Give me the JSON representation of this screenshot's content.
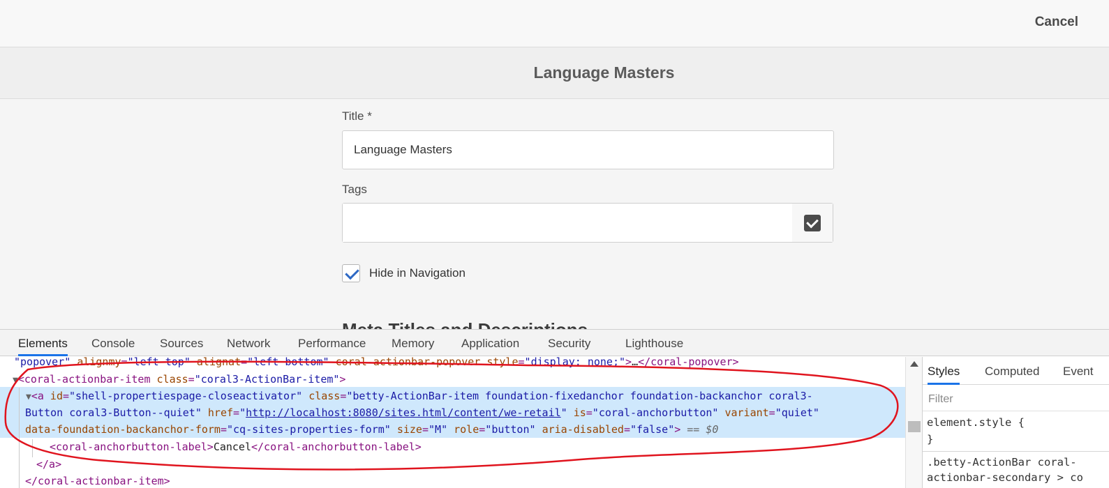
{
  "app": {
    "cancel_label": "Cancel",
    "page_title": "Language Masters",
    "title_field": {
      "label": "Title *",
      "value": "Language Masters"
    },
    "tags_field": {
      "label": "Tags",
      "value": ""
    },
    "hide_in_navigation": {
      "label": "Hide in Navigation",
      "checked": true
    },
    "next_section_heading": "Meta Titles and Descriptions"
  },
  "devtools": {
    "tabs": [
      "Elements",
      "Console",
      "Sources",
      "Network",
      "Performance",
      "Memory",
      "Application",
      "Security",
      "Lighthouse"
    ],
    "active_tab": "Elements",
    "dom": {
      "line0": {
        "v1": "popover",
        "a1": "alignmy",
        "v2": "left top",
        "a2": "alignat",
        "v3": "left bottom",
        "a3": "coral-actionbar-popover",
        "a4": "style",
        "v4": "display: none;",
        "ellipsis": "…",
        "close": "</coral-popover>"
      },
      "line1": {
        "open": "<coral-actionbar-item",
        "a1": "class",
        "v1": "coral3-ActionBar-item",
        "end": ">"
      },
      "selected": {
        "open": "<a",
        "a_id": "id",
        "v_id": "shell-propertiespage-closeactivator",
        "a_class": "class",
        "v_class_1": "betty-ActionBar-item foundation-fixedanchor foundation-backanchor coral3-",
        "v_class_2": "Button coral3-Button--quiet",
        "a_href": "href",
        "v_href": "http://localhost:8080/sites.html/content/we-retail",
        "a_is": "is",
        "v_is": "coral-anchorbutton",
        "a_variant": "variant",
        "v_variant": "quiet",
        "a_form": "data-foundation-backanchor-form",
        "v_form": "cq-sites-properties-form",
        "a_size": "size",
        "v_size": "M",
        "a_role": "role",
        "v_role": "button",
        "a_aria": "aria-disabled",
        "v_aria": "false",
        "end": ">",
        "dollar": "== $0"
      },
      "label_line": {
        "open": "<coral-anchorbutton-label>",
        "text": "Cancel",
        "close": "</coral-anchorbutton-label>"
      },
      "close_a": "</a>",
      "close_item": "</coral-actionbar-item>"
    },
    "styles": {
      "tabs": [
        "Styles",
        "Computed",
        "Event"
      ],
      "filter_placeholder": "Filter",
      "element_style": "element.style {",
      "brace_close": "}",
      "rule_1": ".betty-ActionBar coral-",
      "rule_2": "actionbar-secondary > co"
    }
  }
}
